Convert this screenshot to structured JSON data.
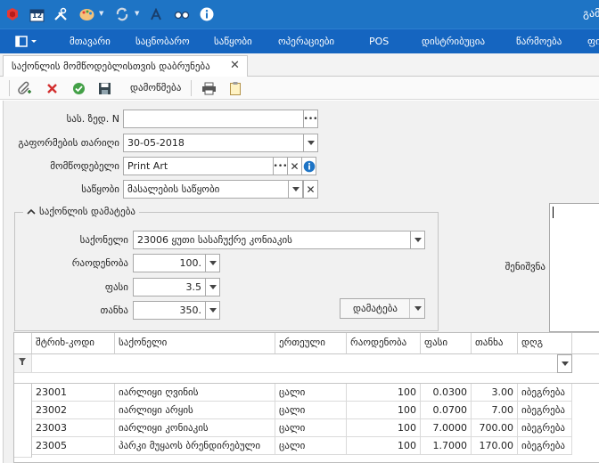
{
  "colors": {
    "toolbar": "#1e74c5",
    "menubar": "#1565c0",
    "form_bg": "#f1f1f1"
  },
  "toolbar": {
    "icons": [
      "app-logo-icon",
      "calendar-icon",
      "tools-icon",
      "palette-icon",
      "sync-icon",
      "chart-icon",
      "glasses-icon",
      "info-icon"
    ],
    "calendar_day": "12",
    "user_text": "გამ"
  },
  "menu": {
    "items": [
      "მთავარი",
      "საცნობარო",
      "საწყობი",
      "ოპერაციები",
      "POS",
      "დისტრიბუცია",
      "წარმოება",
      "ფი"
    ]
  },
  "tab": {
    "title": "საქონლის მომწოდებლისთვის დაბრუნება",
    "close": "✕"
  },
  "doc_toolbar": {
    "check_label": "დამოწმება"
  },
  "form": {
    "doc_no_label": "სას. ზედ. N",
    "doc_no_value": "",
    "date_label": "გაფორმების თარიღი",
    "date_value": "30-05-2018",
    "supplier_label": "მომწოდებელი",
    "supplier_value": "Print Art",
    "warehouse_label": "საწყობი",
    "warehouse_value": "მასალების საწყობი",
    "notes_label": "შენიშვნა"
  },
  "add_group": {
    "title": "საქონლის დამატება",
    "item_label": "საქონელი",
    "item_value": "23006   ყუთი სასაჩუქრე კონიაკის",
    "qty_label": "რაოდენობა",
    "qty_value": "100.",
    "price_label": "ფასი",
    "price_value": "3.5",
    "amount_label": "თანხა",
    "amount_value": "350.",
    "add_button": "დამატება"
  },
  "grid": {
    "columns": [
      "შტრიხ-კოდი",
      "საქონელი",
      "ერთეული",
      "რაოდენობა",
      "ფასი",
      "თანხა",
      "დღგ"
    ],
    "rows": [
      [
        "23001",
        "იარლიყი ღვინის",
        "ცალი",
        "100",
        "0.0300",
        "3.00",
        "იბეგრება"
      ],
      [
        "23002",
        "იარლიყი არყის",
        "ცალი",
        "100",
        "0.0700",
        "7.00",
        "იბეგრება"
      ],
      [
        "23003",
        "იარლიყი კონიაკის",
        "ცალი",
        "100",
        "7.0000",
        "700.00",
        "იბეგრება"
      ],
      [
        "23005",
        "პარკი მუყაოს ბრენდირებული",
        "ცალი",
        "100",
        "1.7000",
        "170.00",
        "იბეგრება"
      ]
    ]
  }
}
